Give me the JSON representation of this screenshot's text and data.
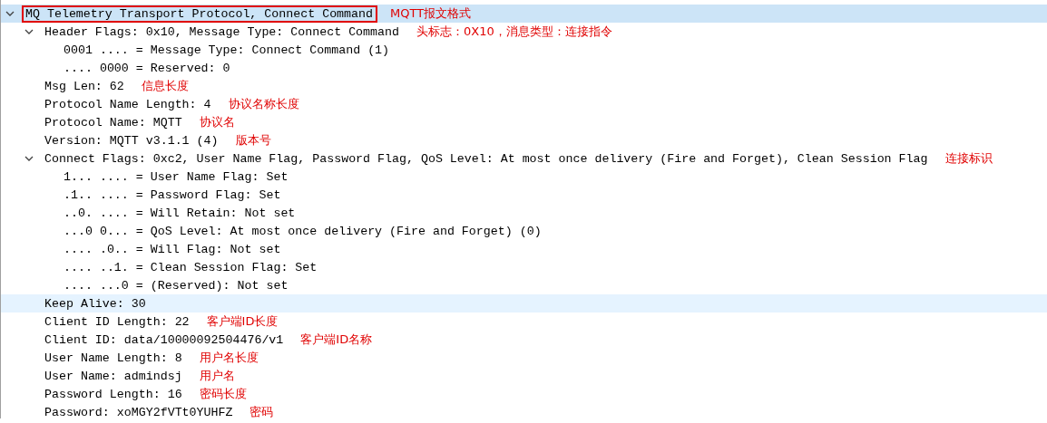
{
  "tree": [
    {
      "text": "MQ Telemetry Transport Protocol, Connect Command",
      "note": "MQTT报文格式",
      "selected": true,
      "hovered": false,
      "outlined": true,
      "expanded": true,
      "children": [
        {
          "text": "Header Flags: 0x10, Message Type: Connect Command",
          "note": "头标志：0X10，消息类型：连接指令",
          "selected": false,
          "hovered": false,
          "outlined": false,
          "expanded": true,
          "children": [
            {
              "text": "0001 .... = Message Type: Connect Command (1)",
              "selected": false,
              "hovered": false,
              "outlined": false
            },
            {
              "text": ".... 0000 = Reserved: 0",
              "selected": false,
              "hovered": false,
              "outlined": false
            }
          ]
        },
        {
          "text": "Msg Len: 62",
          "note": "信息长度",
          "selected": false,
          "hovered": false,
          "outlined": false
        },
        {
          "text": "Protocol Name Length: 4",
          "note": "协议名称长度",
          "selected": false,
          "hovered": false,
          "outlined": false
        },
        {
          "text": "Protocol Name: MQTT",
          "note": "协议名",
          "selected": false,
          "hovered": false,
          "outlined": false
        },
        {
          "text": "Version: MQTT v3.1.1 (4)",
          "note": "版本号",
          "selected": false,
          "hovered": false,
          "outlined": false
        },
        {
          "text": "Connect Flags: 0xc2, User Name Flag, Password Flag, QoS Level: At most once delivery (Fire and Forget), Clean Session Flag",
          "note": "连接标识",
          "selected": false,
          "hovered": false,
          "outlined": false,
          "expanded": true,
          "children": [
            {
              "text": "1... .... = User Name Flag: Set",
              "selected": false,
              "hovered": false,
              "outlined": false
            },
            {
              "text": ".1.. .... = Password Flag: Set",
              "selected": false,
              "hovered": false,
              "outlined": false
            },
            {
              "text": "..0. .... = Will Retain: Not set",
              "selected": false,
              "hovered": false,
              "outlined": false
            },
            {
              "text": "...0 0... = QoS Level: At most once delivery (Fire and Forget) (0)",
              "selected": false,
              "hovered": false,
              "outlined": false
            },
            {
              "text": ".... .0.. = Will Flag: Not set",
              "selected": false,
              "hovered": false,
              "outlined": false
            },
            {
              "text": ".... ..1. = Clean Session Flag: Set",
              "selected": false,
              "hovered": false,
              "outlined": false
            },
            {
              "text": ".... ...0 = (Reserved): Not set",
              "selected": false,
              "hovered": false,
              "outlined": false
            }
          ]
        },
        {
          "text": "Keep Alive: 30",
          "selected": false,
          "hovered": true,
          "outlined": false
        },
        {
          "text": "Client ID Length: 22",
          "note": "客户端ID长度",
          "selected": false,
          "hovered": false,
          "outlined": false
        },
        {
          "text": "Client ID: data/10000092504476/v1",
          "note": "客户端ID名称",
          "selected": false,
          "hovered": false,
          "outlined": false
        },
        {
          "text": "User Name Length: 8",
          "note": "用户名长度",
          "selected": false,
          "hovered": false,
          "outlined": false
        },
        {
          "text": "User Name: admindsj",
          "note": "用户名",
          "selected": false,
          "hovered": false,
          "outlined": false
        },
        {
          "text": "Password Length: 16",
          "note": "密码长度",
          "selected": false,
          "hovered": false,
          "outlined": false
        },
        {
          "text": "Password: xoMGY2fVTt0YUHFZ",
          "note": "密码",
          "selected": false,
          "hovered": false,
          "outlined": false
        }
      ]
    }
  ]
}
